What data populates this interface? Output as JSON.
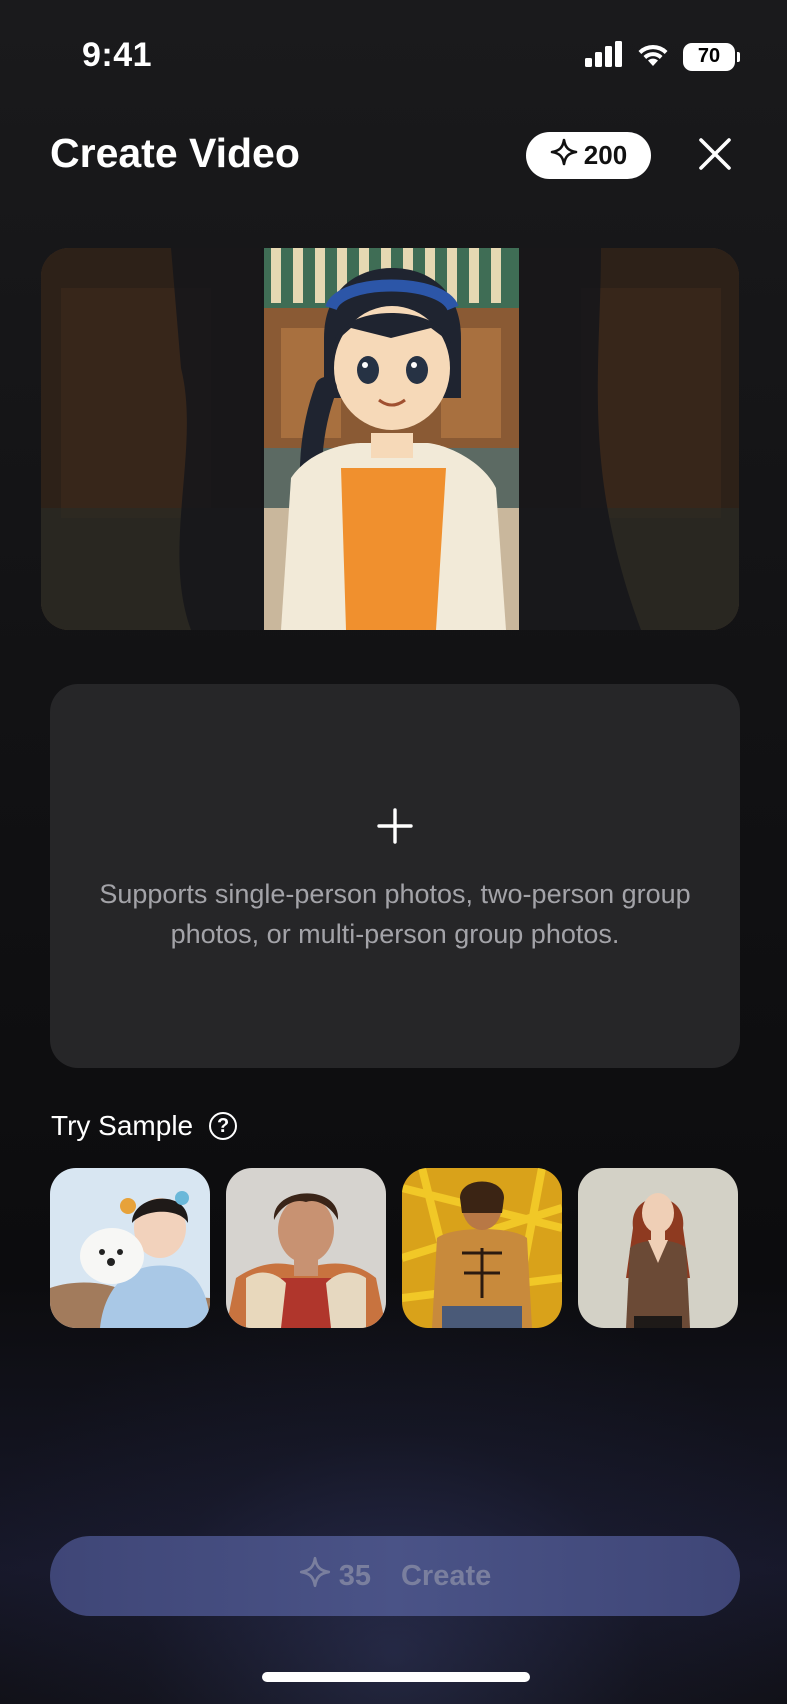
{
  "status_bar": {
    "time": "9:41",
    "battery": "70",
    "icons": [
      "cellular-signal-icon",
      "wifi-icon",
      "battery-icon"
    ]
  },
  "header": {
    "title": "Create Video",
    "credits": "200",
    "credits_icon": "sparkle-icon",
    "close_icon": "close-icon"
  },
  "preview": {
    "description_icon": "pixel-art-preview"
  },
  "upload": {
    "icon": "plus-icon",
    "hint": "Supports single-person photos, two-person group photos, or multi-person group photos."
  },
  "samples": {
    "label": "Try Sample",
    "help_icon": "question-circle-icon",
    "help_glyph": "?",
    "items": [
      {
        "name": "sample-woman-with-dog"
      },
      {
        "name": "sample-young-man"
      },
      {
        "name": "sample-man-golden"
      },
      {
        "name": "sample-woman-redhead"
      }
    ]
  },
  "create_button": {
    "cost": "35",
    "label": "Create",
    "icon": "sparkle-icon"
  },
  "colors": {
    "background": "#121214",
    "panel": "#262628",
    "button": "#4a5387",
    "button_text": "#7a7f9e",
    "hint_text": "#a3a3a8"
  }
}
